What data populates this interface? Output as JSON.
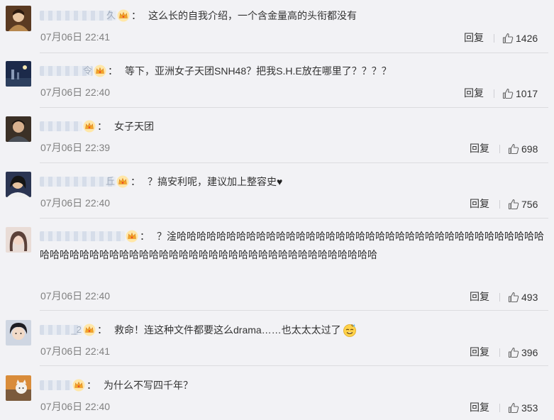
{
  "ui": {
    "reply_label": "回复",
    "colon": "："
  },
  "comments": [
    {
      "user_tail": "久",
      "text": "这么长的自我介绍，一个含金量高的头衔都没有",
      "time": "07月06日 22:41",
      "likes": "1426"
    },
    {
      "user_tail": "令",
      "text": "等下，亚洲女子天团SNH48？把我S.H.E放在哪里了？？？？",
      "time": "07月06日 22:40",
      "likes": "1017"
    },
    {
      "user_tail": "",
      "text": "女子天团",
      "time": "07月06日 22:39",
      "likes": "698"
    },
    {
      "user_tail": "丘",
      "text": "？搞安利呢，建议加上整容史",
      "text_suffix": "♥",
      "time": "07月06日 22:40",
      "likes": "756"
    },
    {
      "user_tail": "",
      "text": "？淦哈哈哈哈哈哈哈哈哈哈哈哈哈哈哈哈哈哈哈哈哈哈哈哈哈哈哈哈哈哈哈哈哈哈哈哈哈哈哈哈哈哈哈哈哈哈哈哈哈哈哈哈哈哈哈哈哈哈哈哈哈哈哈哈哈哈哈哈哈哈哈",
      "time": "07月06日 22:40",
      "likes": "493"
    },
    {
      "user_tail": "_2",
      "text": "救命！连这种文件都要这么drama……也太太太过了",
      "emoji": "sweat-smile-emoji",
      "time": "07月06日 22:41",
      "likes": "396"
    },
    {
      "user_tail": "",
      "text": "为什么不写四千年？",
      "time": "07月06日 22:40",
      "likes": "353"
    }
  ],
  "colors": {
    "background": "#f2f2f5",
    "text": "#333333",
    "timestamp": "#808080",
    "crown": "#f5a623"
  },
  "icons": {
    "crown": "crown-badge-icon",
    "like": "thumbs-up-icon"
  }
}
